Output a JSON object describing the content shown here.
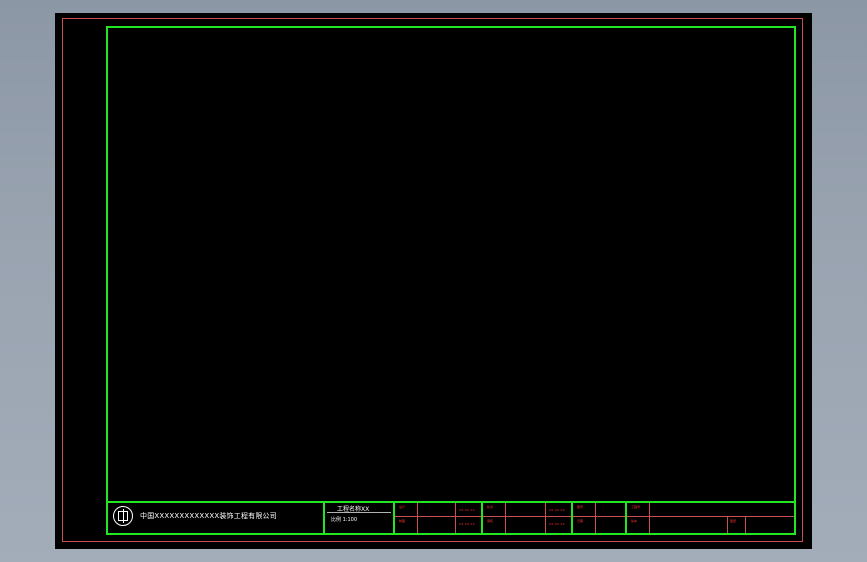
{
  "title_block": {
    "company_name": "中国XXXXXXXXXXXXX装饰工程有限公司",
    "project_title": "工程名称XX",
    "drawing_scale": "比例 1:100",
    "rows": [
      {
        "label_a": "设计",
        "date_a": "XX.XX.XX",
        "label_b": "校对",
        "date_b": "XX.XX.XX",
        "label_c": "图号",
        "label_d": "工程号"
      },
      {
        "label_a": "制图",
        "date_a": "XX.XX.XX",
        "label_b": "审核",
        "date_b": "XX.XX.XX",
        "label_c": "日期",
        "label_d": "版本",
        "label_e": "图纸"
      }
    ]
  },
  "colors": {
    "background": "#000000",
    "frame": "#22e622",
    "sheet_border": "#c85050",
    "text_white": "#ffffff",
    "text_red": "#ff3030"
  },
  "icons": {
    "logo": "company-logo-icon"
  }
}
